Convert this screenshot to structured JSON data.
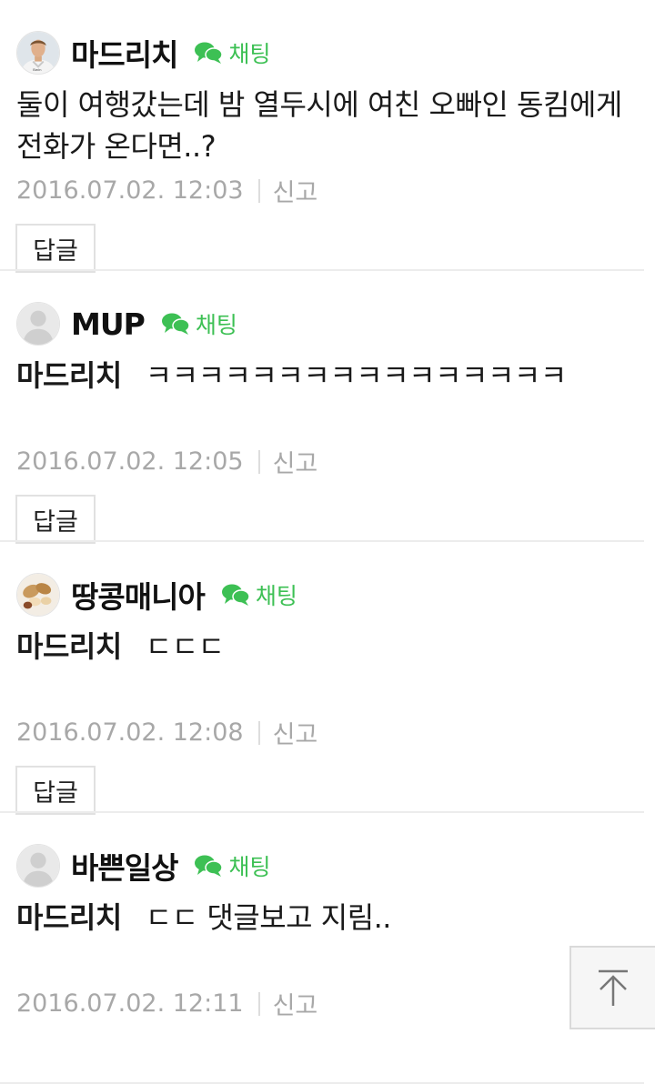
{
  "chat_label": "채팅",
  "report_label": "신고",
  "reply_label": "답글",
  "comments": [
    {
      "nickname": "마드리치",
      "mention": "",
      "text": "둘이 여행갔는데 밤 열두시에 여친 오빠인 동킴에게 전화가 온다면..?",
      "date": "2016.07.02. 12:03",
      "avatar": "soccer-player-photo"
    },
    {
      "nickname": "MUP",
      "mention": "마드리치",
      "text": "ㅋㅋㅋㅋㅋㅋㅋㅋㅋㅋㅋㅋㅋㅋㅋㅋ",
      "date": "2016.07.02. 12:05",
      "avatar": "default-profile"
    },
    {
      "nickname": "땅콩매니아",
      "mention": "마드리치",
      "text": "ㄷㄷㄷ",
      "date": "2016.07.02. 12:08",
      "avatar": "peanut-photo"
    },
    {
      "nickname": "바쁜일상",
      "mention": "마드리치",
      "text": "ㄷㄷ 댓글보고 지림..",
      "date": "2016.07.02. 12:11",
      "avatar": "default-profile"
    }
  ],
  "colors": {
    "chat_green": "#3dc054",
    "meta_gray": "#a8a8a8",
    "divider": "#ececec"
  },
  "icons": {
    "chat": "speech-bubble-icon",
    "scroll_top": "arrow-up-to-top-icon"
  }
}
